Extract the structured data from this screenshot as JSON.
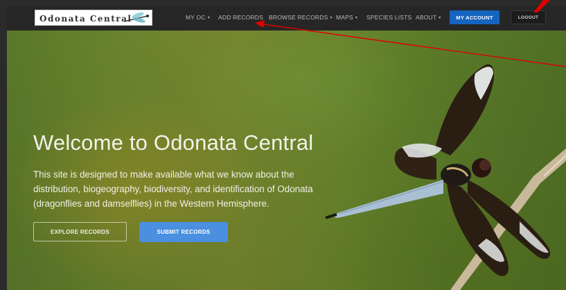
{
  "site": {
    "logo_text": "Odonata Central"
  },
  "nav": {
    "items": [
      {
        "label": "MY OC",
        "dropdown": true
      },
      {
        "label": "ADD RECORDS",
        "dropdown": false
      },
      {
        "label": "BROWSE RECORDS",
        "dropdown": true
      },
      {
        "label": "MAPS",
        "dropdown": true
      },
      {
        "label": "SPECIES LISTS",
        "dropdown": false
      },
      {
        "label": "ABOUT",
        "dropdown": true
      }
    ],
    "account_label": "MY ACCOUNT",
    "logout_label": "LOGOUT"
  },
  "hero": {
    "title": "Welcome to Odonata Central",
    "text_lines": [
      "This site is designed to make available what we know about the",
      "distribution, biogeography, biodiversity, and identification of Odonata",
      "(dragonflies and damselflies) in the Western Hemisphere."
    ],
    "explore_label": "EXPLORE RECORDS",
    "submit_label": "SUBMIT RECORDS"
  },
  "icons": {
    "caret": "▾",
    "logo_image": "dragonfly-logo-icon",
    "hero_image": "widow-skimmer-dragonfly-photo",
    "annotation": "red-arrow-annotation"
  },
  "colors": {
    "topbar": "#262626",
    "account_button": "#1565c0",
    "submit_button": "#4a8fe0",
    "annotation": "#e00000"
  }
}
